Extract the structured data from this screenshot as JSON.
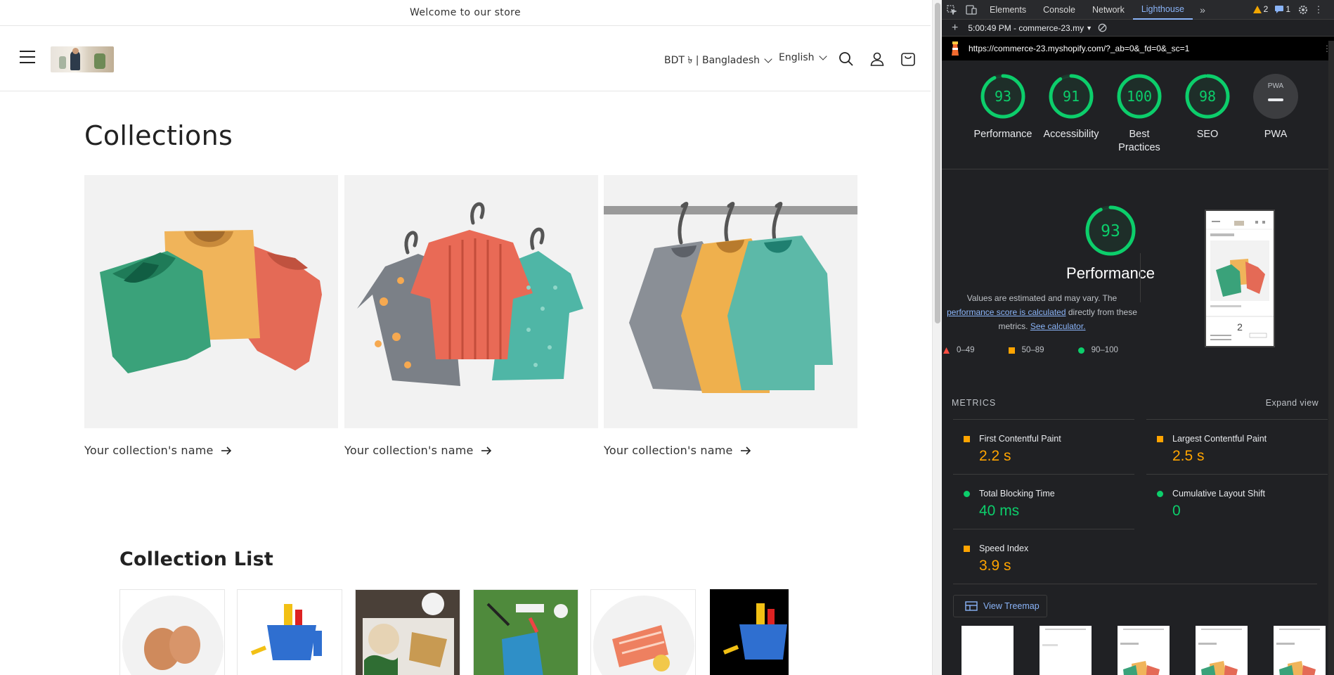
{
  "store": {
    "announcement": "Welcome to our store",
    "currency": "BDT ৳ | Bangladesh",
    "language": "English",
    "collections_title": "Collections",
    "collections": [
      {
        "name": "Your collection's name"
      },
      {
        "name": "Your collection's name"
      },
      {
        "name": "Your collection's name"
      }
    ],
    "collection_list_title": "Collection List"
  },
  "devtools": {
    "tabs": [
      "Elements",
      "Console",
      "Network",
      "Lighthouse"
    ],
    "active_tab": "Lighthouse",
    "warnings_count": "2",
    "messages_count": "1",
    "report_select": "5:00:49 PM - commerce-23.my",
    "url": "https://commerce-23.myshopify.com/?_ab=0&_fd=0&_sc=1",
    "scores": [
      {
        "label": "Performance",
        "value": "93",
        "fraction": 0.93
      },
      {
        "label": "Accessibility",
        "value": "91",
        "fraction": 0.91
      },
      {
        "label": "Best Practices",
        "value": "100",
        "fraction": 1.0
      },
      {
        "label": "SEO",
        "value": "98",
        "fraction": 0.98
      },
      {
        "label": "PWA",
        "value": "",
        "fraction": 0
      }
    ],
    "pwa_badge": "PWA",
    "performance": {
      "score": "93",
      "score_fraction": 0.93,
      "title": "Performance",
      "desc_1": "Values are estimated and may vary. The",
      "desc_link": "performance score is calculated",
      "desc_2": "directly from these metrics.",
      "calc_link": "See calculator."
    },
    "legend": [
      "0–49",
      "50–89",
      "90–100"
    ],
    "metrics_header": "METRICS",
    "expand_view": "Expand view",
    "metrics": [
      {
        "name": "First Contentful Paint",
        "value": "2.2 s",
        "status": "average"
      },
      {
        "name": "Largest Contentful Paint",
        "value": "2.5 s",
        "status": "average"
      },
      {
        "name": "Total Blocking Time",
        "value": "40 ms",
        "status": "pass"
      },
      {
        "name": "Cumulative Layout Shift",
        "value": "0",
        "status": "pass"
      },
      {
        "name": "Speed Index",
        "value": "3.9 s",
        "status": "average"
      }
    ],
    "view_treemap": "View Treemap",
    "colors": {
      "pass": "#0cce6b",
      "average": "#ffa400",
      "fail": "#ff4e42",
      "link": "#8ab4f8"
    }
  }
}
